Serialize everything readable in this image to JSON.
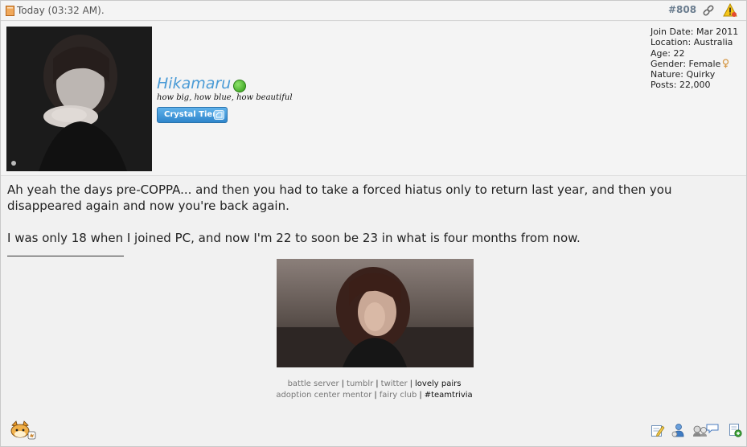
{
  "header": {
    "date": "Today (03:32 AM).",
    "post_number": "#808",
    "link_icon": "link-icon",
    "report_icon": "report-warning-icon"
  },
  "user": {
    "username": "Hikamaru",
    "online_status": "online",
    "usertitle": "how big, how blue, how beautiful",
    "tier_badge": "Crystal Tier",
    "stats": {
      "join_date": "Join Date: Mar 2011",
      "location": "Location: Australia",
      "age": "Age: 22",
      "gender": "Gender: Female",
      "nature": "Nature: Quirky",
      "posts": "Posts: 22,000"
    }
  },
  "post": {
    "paragraph1": "Ah yeah the days pre-COPPA... and then you had to take a forced hiatus only to return last year, and then you disappeared again and now you're back again.",
    "paragraph2": "I was only 18 when I joined PC, and now I'm 22 to soon be 23 in what is four months from now."
  },
  "signature": {
    "line1": [
      "battle server",
      "tumblr",
      "twitter",
      "lovely pairs"
    ],
    "line2": [
      "adoption center mentor",
      "fairy club",
      "#teamtrivia"
    ],
    "separator": "|"
  },
  "footer": {
    "left_icon": "pokemon-sprite-icon",
    "buttons": [
      "edit-icon",
      "user-profile-icon",
      "multiquote-icon",
      "reply-quote-icon"
    ]
  },
  "colors": {
    "username": "#4a9bd6",
    "badge": "#3d95d8",
    "online": "#3fb41f",
    "background": "#f1f1f1"
  }
}
